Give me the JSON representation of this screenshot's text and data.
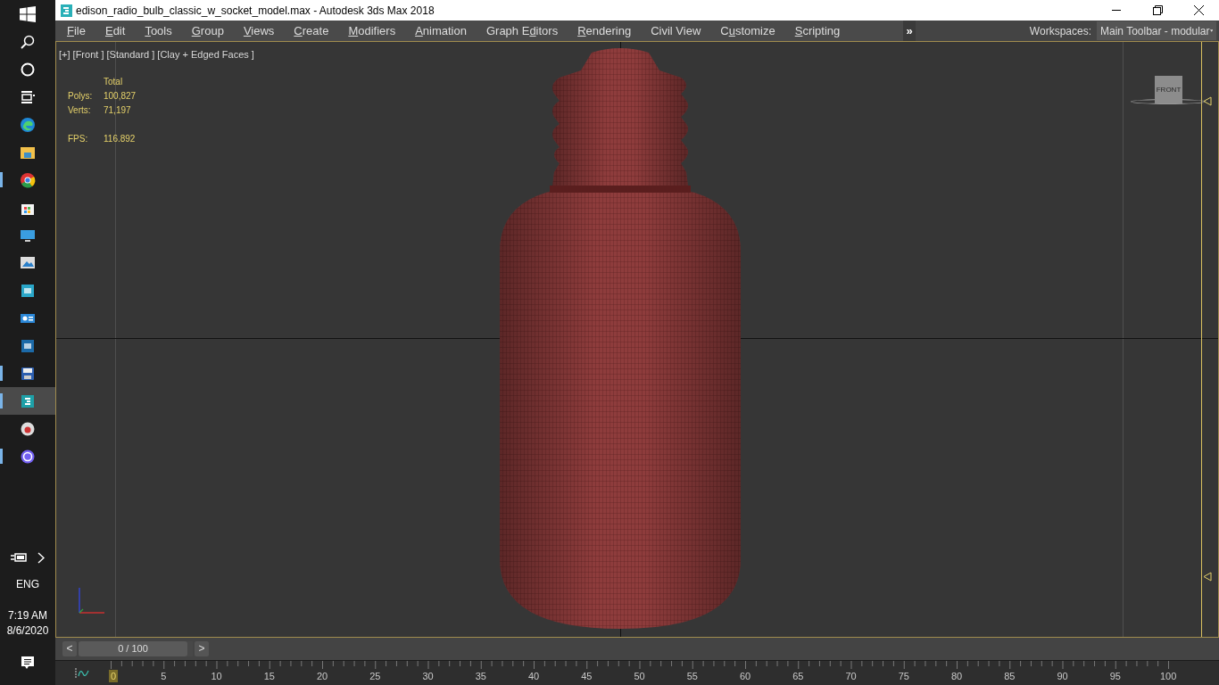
{
  "taskbar": {
    "apps": [
      {
        "kind": "edge",
        "running": false,
        "selected": false
      },
      {
        "kind": "folder",
        "running": false,
        "selected": false
      },
      {
        "kind": "chrome",
        "running": true,
        "selected": false
      },
      {
        "kind": "store",
        "running": false,
        "selected": false
      },
      {
        "kind": "monitor",
        "running": false,
        "selected": false
      },
      {
        "kind": "photos",
        "running": false,
        "selected": false
      },
      {
        "kind": "tile",
        "running": false,
        "selected": false,
        "color": "#2aa7c9"
      },
      {
        "kind": "card",
        "running": false,
        "selected": false
      },
      {
        "kind": "tile",
        "running": false,
        "selected": false,
        "color": "#1c6aa8"
      },
      {
        "kind": "disk",
        "running": true,
        "selected": false
      },
      {
        "kind": "max",
        "running": true,
        "selected": true
      },
      {
        "kind": "record",
        "running": false,
        "selected": false
      },
      {
        "kind": "phone",
        "running": true,
        "selected": false
      }
    ],
    "language": "ENG",
    "time": "7:19 AM",
    "date": "8/6/2020"
  },
  "window": {
    "title": "edison_radio_bulb_classic_w_socket_model.max - Autodesk 3ds Max 2018"
  },
  "menu": [
    {
      "key": "F",
      "post": "ile"
    },
    {
      "key": "E",
      "post": "dit"
    },
    {
      "key": "T",
      "post": "ools"
    },
    {
      "key": "G",
      "post": "roup"
    },
    {
      "key": "V",
      "post": "iews"
    },
    {
      "key": "C",
      "post": "reate"
    },
    {
      "key": "M",
      "post": "odifiers"
    },
    {
      "key": "A",
      "post": "nimation"
    },
    {
      "pre": "Graph E",
      "key": "d",
      "post": "itors"
    },
    {
      "key": "R",
      "post": "endering"
    },
    {
      "pre": "Civil View"
    },
    {
      "pre": "C",
      "key": "u",
      "post": "stomize"
    },
    {
      "key": "S",
      "post": "cripting"
    }
  ],
  "overflow": "»",
  "workspaces": {
    "label": "Workspaces:",
    "value": "Main Toolbar - modular"
  },
  "viewport": {
    "label": "[+] [Front ] [Standard ] [Clay + Edged Faces ]",
    "stats": {
      "header": "Total",
      "rows": [
        {
          "label": "Polys:",
          "value": "100,827"
        },
        {
          "label": "Verts:",
          "value": "71,197"
        }
      ],
      "fps_label": "FPS:",
      "fps": "116.892"
    },
    "viewcube": "FRONT"
  },
  "time_slider": {
    "prev": "<",
    "value": "0 / 100",
    "next": ">",
    "level": 0
  },
  "track": {
    "labels": [
      "0",
      "5",
      "10",
      "15",
      "20",
      "25",
      "30",
      "35",
      "40",
      "45",
      "50",
      "55",
      "60",
      "65",
      "70",
      "75",
      "80",
      "85",
      "90",
      "95",
      "100"
    ]
  }
}
